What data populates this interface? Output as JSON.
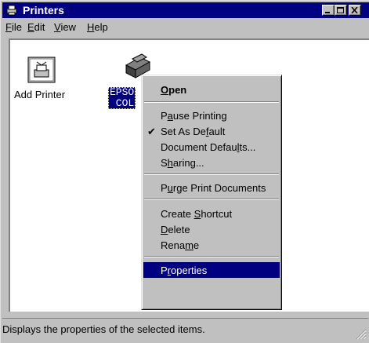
{
  "window": {
    "title": "Printers",
    "controls": [
      "minimize",
      "maximize",
      "close"
    ]
  },
  "menubar": {
    "items": [
      {
        "label": "File",
        "accel": "F"
      },
      {
        "label": "Edit",
        "accel": "E"
      },
      {
        "label": "View",
        "accel": "V"
      },
      {
        "label": "Help",
        "accel": "H"
      }
    ]
  },
  "icons": {
    "add_printer": {
      "label": "Add Printer",
      "icon": "add-printer-icon"
    },
    "epson": {
      "label_line1": "EPSO",
      "label_line2": " COL",
      "icon": "printer-icon",
      "selected": true
    }
  },
  "context_menu": {
    "items": [
      {
        "label": "Open",
        "underline": "O",
        "bold": true
      },
      {
        "label": "Pause Printing",
        "underline": "a"
      },
      {
        "label": "Set As Default",
        "underline": "f",
        "checked": true
      },
      {
        "label": "Document Defaults...",
        "underline": "l"
      },
      {
        "label": "Sharing...",
        "underline": "h"
      },
      {
        "label": "Purge Print Documents",
        "underline": "u"
      },
      {
        "label": "Create Shortcut",
        "underline": "S"
      },
      {
        "label": "Delete",
        "underline": "D"
      },
      {
        "label": "Rename",
        "underline": "m"
      },
      {
        "label": "Properties",
        "underline": "r",
        "selected": true
      }
    ]
  },
  "statusbar": {
    "text": "Displays the properties of the selected items."
  }
}
